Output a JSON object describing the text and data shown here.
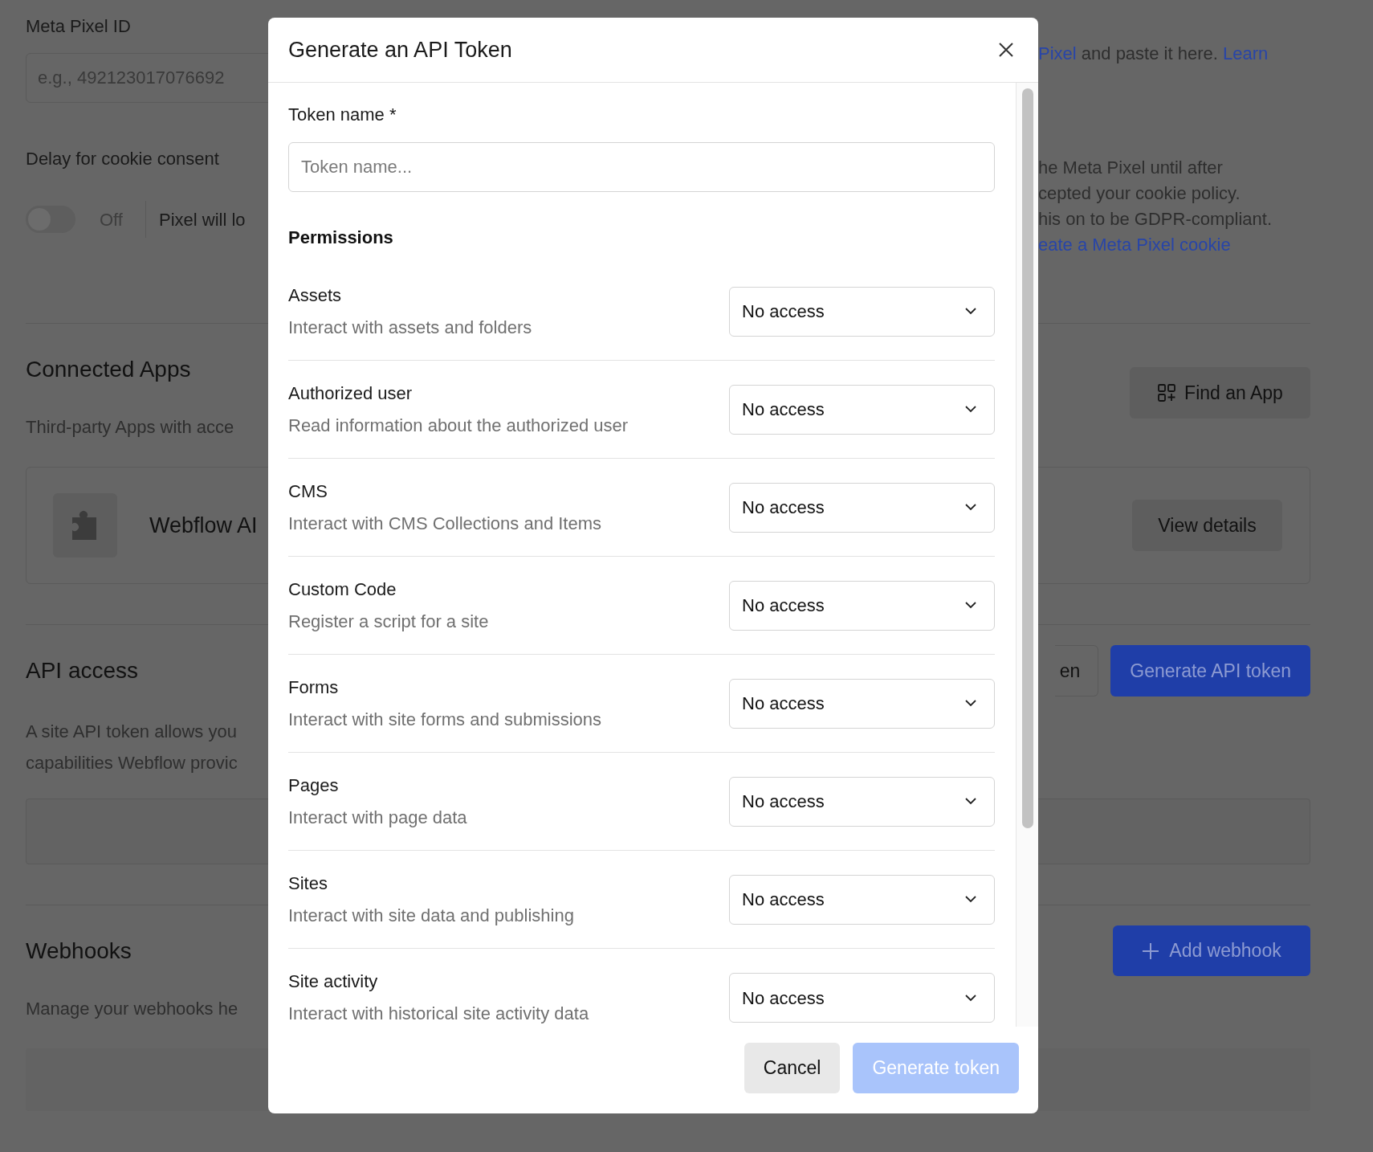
{
  "background": {
    "pixel_id": {
      "label": "Meta Pixel ID",
      "placeholder": "e.g., 492123017076692"
    },
    "pixel_help": [
      {
        "text": "Pixel",
        "link": true
      },
      {
        "text": "and paste it here.",
        "link": false
      },
      {
        "text": "Learn",
        "link": true
      }
    ],
    "cookie": {
      "label": "Delay for cookie consent",
      "toggle": {
        "on": false,
        "label": "Off"
      },
      "note": "Pixel will lo",
      "help_lines": [
        "he Meta Pixel until after",
        "cepted your cookie policy.",
        "his on to be GDPR-compliant."
      ],
      "help_link": "eate a Meta Pixel cookie"
    },
    "connected_apps": {
      "title": "Connected Apps",
      "description": "Third-party Apps with acce",
      "button": "Find an App",
      "app": {
        "name": "Webflow AI",
        "button": "View details"
      }
    },
    "api_access": {
      "title": "API access",
      "description_lines": [
        "A site API token allows you",
        "capabilities Webflow provic"
      ],
      "buttons": [
        {
          "label": "en",
          "kind": "secondary"
        },
        {
          "label": "Generate API token",
          "kind": "primary"
        }
      ]
    },
    "webhooks": {
      "title": "Webhooks",
      "description": "Manage your webhooks he",
      "button": "Add webhook"
    }
  },
  "dialog": {
    "title": "Generate an API Token",
    "token_field": {
      "label": "Token name",
      "required_mark": "*",
      "placeholder": "Token name..."
    },
    "permissions_title": "Permissions",
    "permissions": [
      {
        "name": "Assets",
        "description": "Interact with assets and folders",
        "value": "No access"
      },
      {
        "name": "Authorized user",
        "description": "Read information about the authorized user",
        "value": "No access"
      },
      {
        "name": "CMS",
        "description": "Interact with CMS Collections and Items",
        "value": "No access"
      },
      {
        "name": "Custom Code",
        "description": "Register a script for a site",
        "value": "No access"
      },
      {
        "name": "Forms",
        "description": "Interact with site forms and submissions",
        "value": "No access"
      },
      {
        "name": "Pages",
        "description": "Interact with page data",
        "value": "No access"
      },
      {
        "name": "Sites",
        "description": "Interact with site data and publishing",
        "value": "No access"
      },
      {
        "name": "Site activity",
        "description": "Interact with historical site activity data",
        "value": "No access"
      }
    ],
    "buttons": [
      {
        "label": "Cancel",
        "kind": "secondary",
        "disabled": false
      },
      {
        "label": "Generate token",
        "kind": "primary",
        "disabled": true
      }
    ]
  }
}
